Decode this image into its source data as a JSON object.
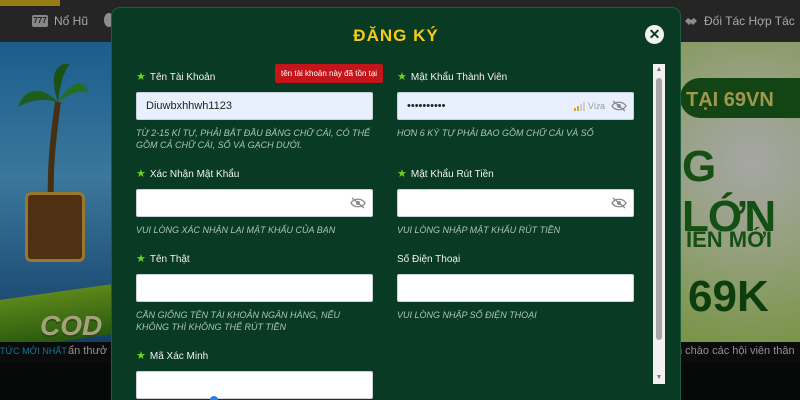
{
  "background": {
    "nav_left": {
      "icon": "777",
      "label": "Nổ Hũ"
    },
    "nav_right": {
      "label": "Đối Tác Hợp Tác"
    },
    "banner_left": {
      "text": "COD"
    },
    "banner_right": {
      "line1": "TẠI 69VN",
      "line2": "G LỚN",
      "line3": "IÊN MỚI",
      "line4": "69K"
    },
    "ticker": {
      "tag": "TỨC MỚI NHẤT",
      "left_text": "ẩn thưở",
      "right_text": "n chào các hội viên thân"
    }
  },
  "modal": {
    "title": "ĐĂNG KÝ",
    "close_icon": "close-icon",
    "fields": {
      "username": {
        "label": "Tên Tài Khoản",
        "value": "Diuwbxhhwh1123",
        "error": "tên tài khoản này đã tồn tại",
        "hint": "TỪ 2-15 KÍ TỰ, PHẢI BẮT ĐẦU BẰNG CHỮ CÁI, CÓ THỂ GỒM CẢ CHỮ CÁI, SỐ VÀ GẠCH DƯỚI."
      },
      "password": {
        "label": "Mật Khẩu Thành Viên",
        "value": "••••••••••",
        "strength": "Vừa",
        "strength_level": 0.5,
        "hint": "HƠN 6 KÝ TỰ PHẢI BAO GỒM CHỮ CÁI VÀ SỐ"
      },
      "confirm_password": {
        "label": "Xác Nhận Mật Khẩu",
        "value": "",
        "hint": "VUI LÒNG XÁC NHẬN LẠI MẬT KHẨU CỦA BẠN"
      },
      "withdraw_password": {
        "label": "Mật Khẩu Rút Tiền",
        "value": "",
        "hint": "VUI LÒNG NHẬP MẬT KHẨU RÚT TIỀN"
      },
      "real_name": {
        "label": "Tên Thật",
        "value": "",
        "hint": "CẦN GIỐNG TÊN TÀI KHOẢN NGÂN HÀNG, NẾU KHÔNG THÌ KHÔNG THỂ RÚT TIỀN"
      },
      "phone": {
        "label": "Số Điện Thoại",
        "value": "",
        "hint": "VUI LÒNG NHẬP SỐ ĐIỆN THOẠI"
      },
      "captcha": {
        "label": "Mã Xác Minh",
        "value": ""
      }
    }
  },
  "colors": {
    "modal_bg": "#093a23",
    "title": "#f5cd17",
    "required_star": "#6fd11e",
    "error_bg": "#c4151a",
    "hint": "#aac6b6"
  }
}
